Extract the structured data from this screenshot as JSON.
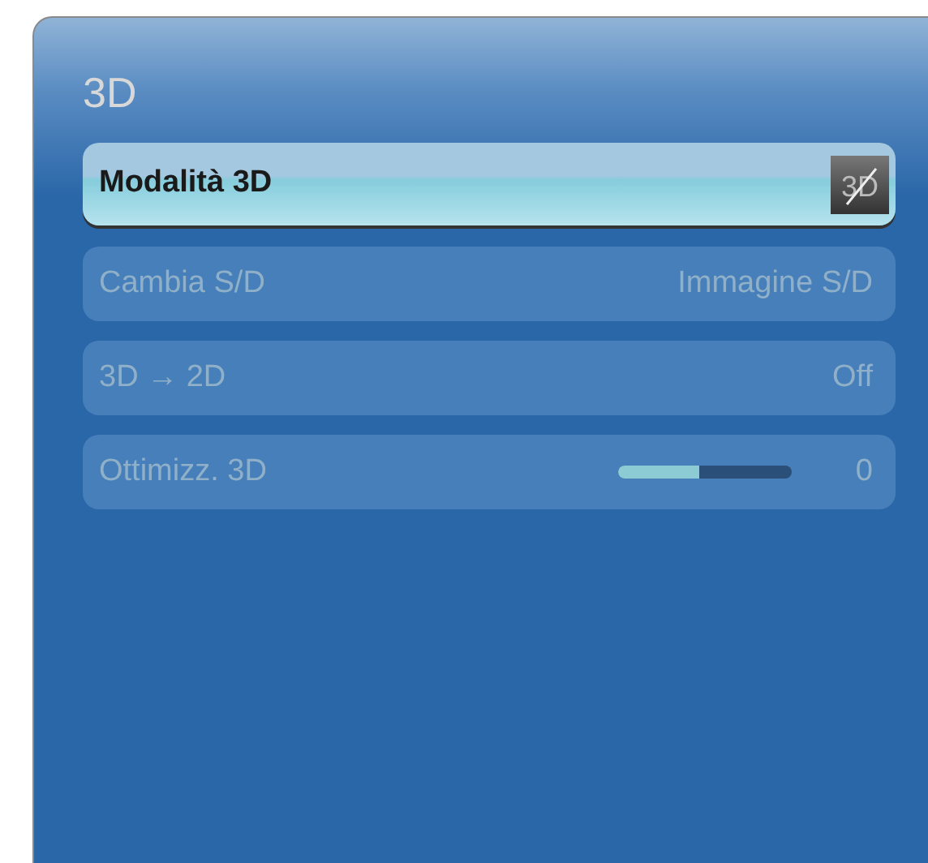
{
  "title": "3D",
  "items": [
    {
      "kind": "icon",
      "label": "Modalità 3D",
      "icon_text": "3D",
      "selected": true,
      "disabled": false
    },
    {
      "kind": "value",
      "label": "Cambia S/D",
      "value": "Immagine S/D",
      "selected": false,
      "disabled": true
    },
    {
      "kind": "value",
      "label": "3D → 2D",
      "value": "Off",
      "selected": false,
      "disabled": true
    },
    {
      "kind": "slider",
      "label": "Ottimizz. 3D",
      "value": "0",
      "level": 0.47,
      "selected": false,
      "disabled": true
    }
  ]
}
